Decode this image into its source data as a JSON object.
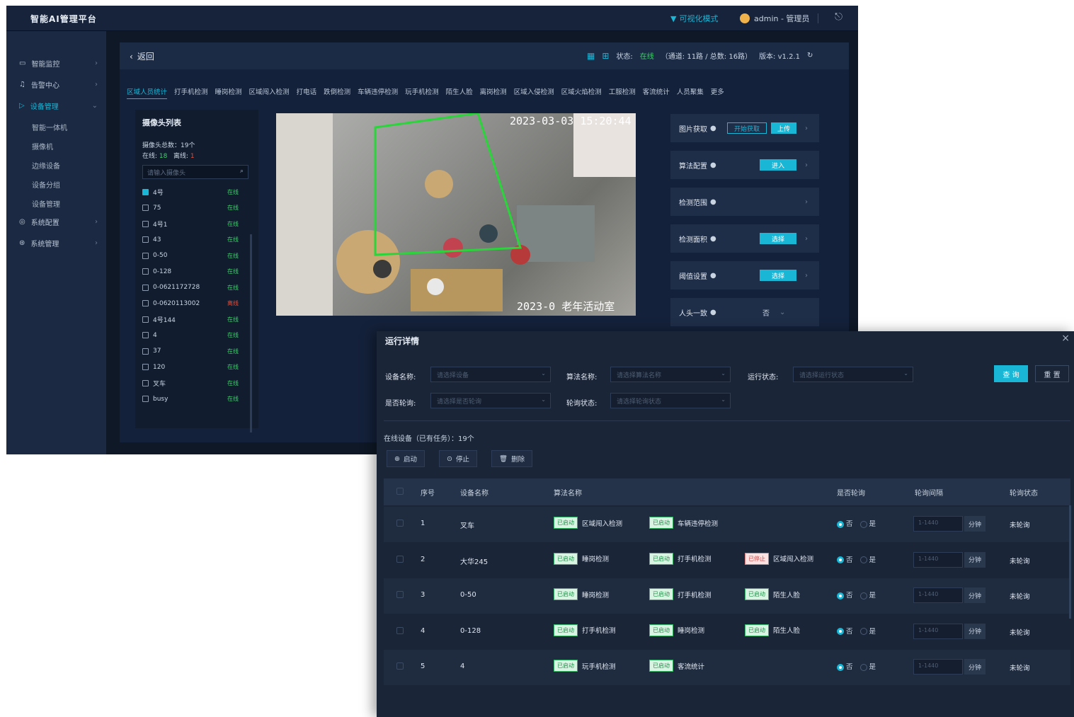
{
  "app": {
    "brand": "智能AI管理平台",
    "filter_label": "可视化模式",
    "user": "admin - 管理员"
  },
  "sidebar": {
    "items": [
      {
        "label": "智能监控",
        "icon": "monitor-icon"
      },
      {
        "label": "告警中心",
        "icon": "bell-icon"
      },
      {
        "label": "设备管理",
        "icon": "camera-icon"
      },
      {
        "label": "系统配置",
        "icon": "gear-icon"
      },
      {
        "label": "系统管理",
        "icon": "settings-icon"
      }
    ],
    "subitems": [
      "智能一体机",
      "摄像机",
      "边缘设备",
      "设备分组",
      "设备管理"
    ]
  },
  "header": {
    "back_label": "返回",
    "status_prefix": "状态:",
    "status_value": "在线",
    "status_detail": "（通道: 11路 / 总数: 16路）",
    "version": "版本: v1.2.1"
  },
  "tabs": [
    "区域人员统计",
    "打手机检测",
    "睡岗检测",
    "区域闯入检测",
    "打电话",
    "跌倒检测",
    "车辆违停检测",
    "玩手机检测",
    "陌生人脸",
    "离岗检测",
    "区域入侵检测",
    "区域火焰检测",
    "工服检测",
    "客流统计",
    "人员聚集",
    "更多"
  ],
  "camera_panel": {
    "title": "摄像头列表",
    "total": "摄像头总数：19个",
    "online_label": "在线",
    "online_count": "18",
    "offline_label": "离线",
    "offline_count": "1",
    "search_placeholder": "请输入摄像头",
    "online_text": "在线",
    "offline_text": "离线",
    "rows": [
      {
        "name": "4号",
        "online": true,
        "checked": true
      },
      {
        "name": "75",
        "online": true,
        "checked": false
      },
      {
        "name": "4号1",
        "online": true,
        "checked": false
      },
      {
        "name": "43",
        "online": true,
        "checked": false
      },
      {
        "name": "0-50",
        "online": true,
        "checked": false
      },
      {
        "name": "0-128",
        "online": true,
        "checked": false
      },
      {
        "name": "0-0621172728",
        "online": true,
        "checked": false
      },
      {
        "name": "0-0620113002",
        "online": false,
        "checked": false
      },
      {
        "name": "4号144",
        "online": true,
        "checked": false
      },
      {
        "name": "4",
        "online": true,
        "checked": false
      },
      {
        "name": "37",
        "online": true,
        "checked": false
      },
      {
        "name": "120",
        "online": true,
        "checked": false
      },
      {
        "name": "叉车",
        "online": true,
        "checked": false
      },
      {
        "name": "busy",
        "online": true,
        "checked": false
      }
    ]
  },
  "video": {
    "timestamp_top": "2023-03-03 15:20:44",
    "timestamp_bottom": "2023-0 老年活动室"
  },
  "config": {
    "rows": [
      {
        "label": "图片获取",
        "btn_outline": "开始获取",
        "btn_solid": "上传"
      },
      {
        "label": "算法配置",
        "btn_solid": "进入"
      },
      {
        "label": "检测范围"
      },
      {
        "label": "检测面积",
        "btn_solid": "选择"
      },
      {
        "label": "阈值设置",
        "btn_solid": "选择"
      },
      {
        "label": "人头一致",
        "value": "否"
      }
    ]
  },
  "modal": {
    "title": "运行详情",
    "close": "×",
    "filters": {
      "device_label": "设备名称:",
      "device_placeholder": "请选择设备",
      "algo_label": "算法名称:",
      "algo_placeholder": "请选择算法名称",
      "run_label": "运行状态:",
      "run_placeholder": "请选择运行状态",
      "poll_label": "是否轮询:",
      "poll_placeholder": "请选择是否轮询",
      "pstate_label": "轮询状态:",
      "pstate_placeholder": "请选择轮询状态",
      "query": "查 询",
      "reset": "重 置"
    },
    "online_count": "在线设备（已有任务）：19个",
    "actions": {
      "start": "启动",
      "stop": "停止",
      "delete": "删除"
    },
    "columns": {
      "index": "序号",
      "device": "设备名称",
      "algo": "算法名称",
      "poll": "是否轮询",
      "interval": "轮询间隔",
      "state": "轮询状态"
    },
    "radio_no": "否",
    "radio_yes": "是",
    "interval_placeholder": "1-1440",
    "interval_unit": "分钟",
    "rows": [
      {
        "index": "1",
        "device": "叉车",
        "state": "未轮询",
        "algos": [
          {
            "tag": "已启动",
            "name": "区域闯入检测",
            "on": true
          },
          {
            "tag": "已启动",
            "name": "车辆违停检测",
            "on": true
          }
        ]
      },
      {
        "index": "2",
        "device": "大华245",
        "state": "未轮询",
        "algos": [
          {
            "tag": "已启动",
            "name": "睡岗检测",
            "on": true
          },
          {
            "tag": "已启动",
            "name": "打手机检测",
            "on": true
          },
          {
            "tag": "已停止",
            "name": "区域闯入检测",
            "on": false
          }
        ]
      },
      {
        "index": "3",
        "device": "0-50",
        "state": "未轮询",
        "algos": [
          {
            "tag": "已启动",
            "name": "睡岗检测",
            "on": true
          },
          {
            "tag": "已启动",
            "name": "打手机检测",
            "on": true
          },
          {
            "tag": "已启动",
            "name": "陌生人脸",
            "on": true
          }
        ]
      },
      {
        "index": "4",
        "device": "0-128",
        "state": "未轮询",
        "algos": [
          {
            "tag": "已启动",
            "name": "打手机检测",
            "on": true
          },
          {
            "tag": "已启动",
            "name": "睡岗检测",
            "on": true
          },
          {
            "tag": "已启动",
            "name": "陌生人脸",
            "on": true
          }
        ]
      },
      {
        "index": "5",
        "device": "4",
        "state": "未轮询",
        "algos": [
          {
            "tag": "已启动",
            "name": "玩手机检测",
            "on": true
          },
          {
            "tag": "已启动",
            "name": "客流统计",
            "on": true
          }
        ]
      }
    ]
  }
}
